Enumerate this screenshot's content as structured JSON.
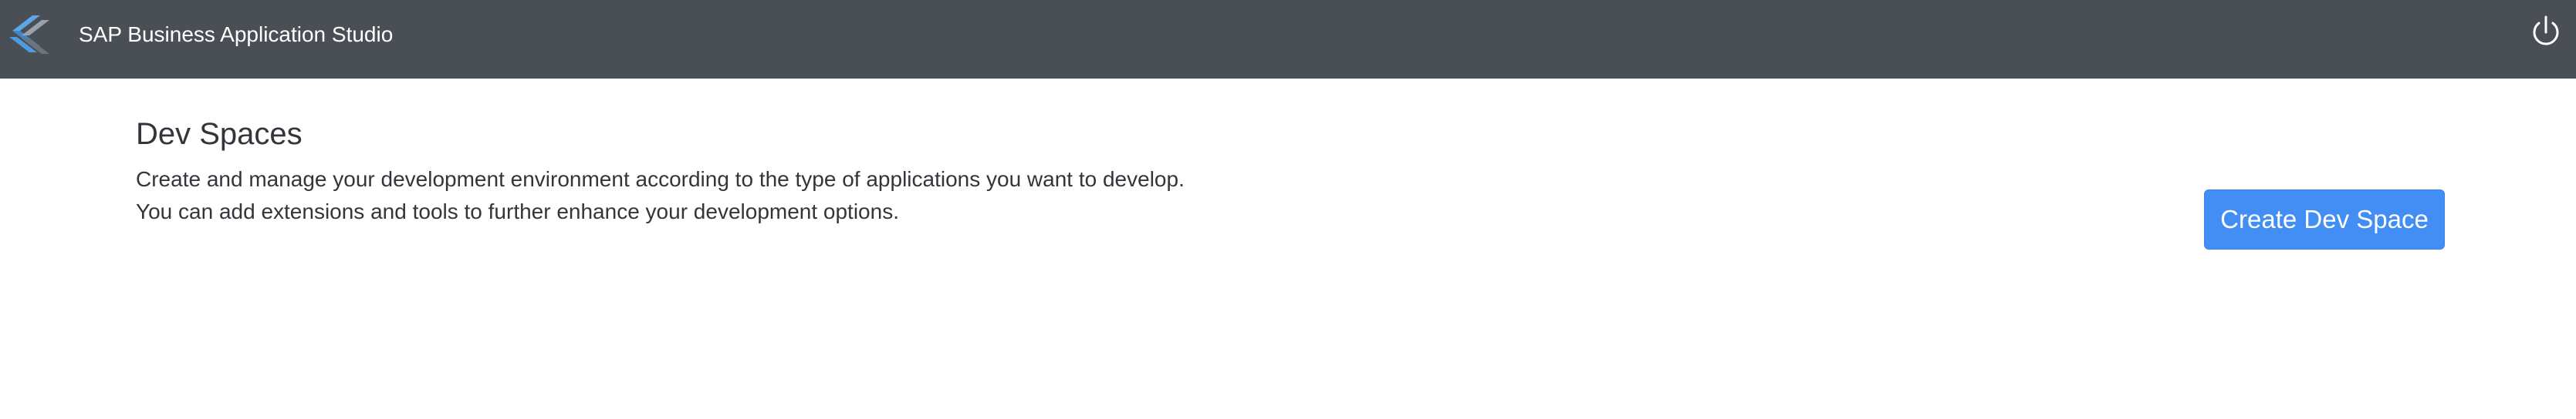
{
  "header": {
    "app_title": "SAP Business Application Studio",
    "logo_icon": "sap-bas-logo-icon",
    "power_icon": "power-icon",
    "background_color": "#4a4f55"
  },
  "main": {
    "title": "Dev Spaces",
    "description_lines": [
      "Create and manage your development environment according to the type of applications you want to develop.",
      "You can add extensions and tools to further enhance your development options."
    ],
    "create_button_label": "Create Dev Space",
    "accent_color": "#428ef5"
  }
}
